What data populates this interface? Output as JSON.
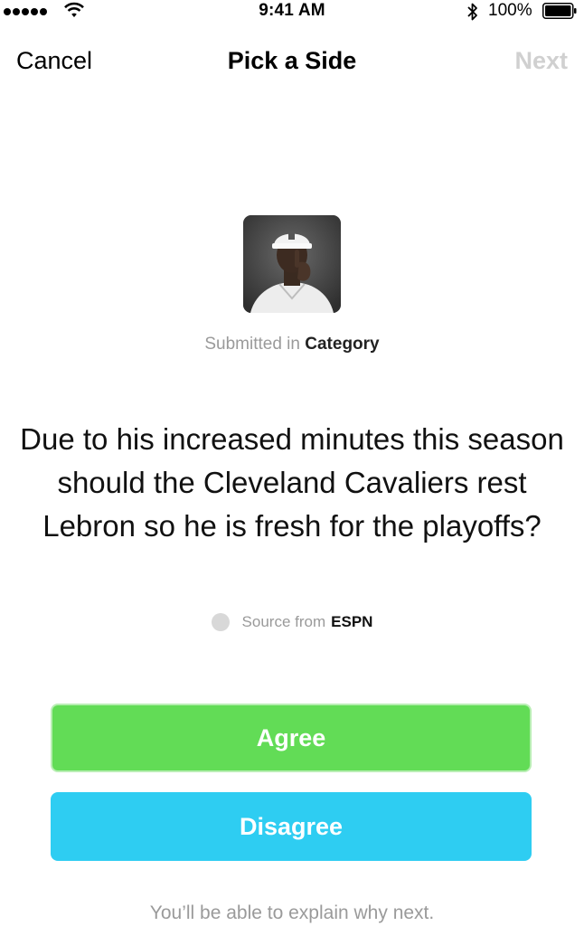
{
  "status_bar": {
    "time": "9:41 AM",
    "battery_percent": "100%",
    "signal_icon": "signal-dots-icon",
    "wifi_icon": "wifi-icon",
    "bluetooth_icon": "bluetooth-icon",
    "battery_icon": "battery-full-icon"
  },
  "nav": {
    "cancel_label": "Cancel",
    "title": "Pick a Side",
    "next_label": "Next"
  },
  "post": {
    "thumbnail_icon": "profile-photo",
    "submitted_prefix": "Submitted in",
    "category": "Category",
    "question": "Due to his increased minutes this season should the Cleveland Cavaliers rest Lebron so he is fresh for the playoffs?",
    "source_prefix": "Source from",
    "source_name": "ESPN"
  },
  "actions": {
    "agree_label": "Agree",
    "disagree_label": "Disagree",
    "footnote": "You’ll be able to explain why next."
  },
  "colors": {
    "agree": "#62dc56",
    "disagree": "#2ecdf2",
    "next_disabled": "#d0d0d0",
    "muted_text": "#9a9a9a"
  }
}
